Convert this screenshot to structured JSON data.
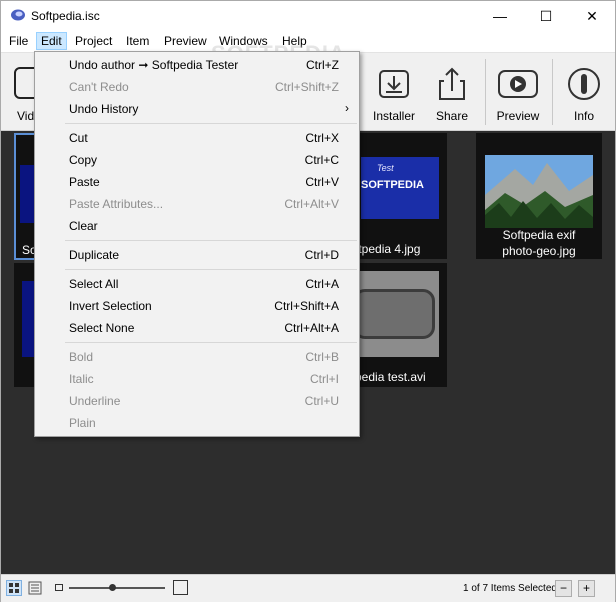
{
  "window": {
    "title": "Softpedia.isc",
    "controls": {
      "minimize": "—",
      "maximize": "☐",
      "close": "✕"
    }
  },
  "menubar": [
    "File",
    "Edit",
    "Project",
    "Item",
    "Preview",
    "Windows",
    "Help"
  ],
  "toolbar": {
    "partial_label": "Vid",
    "tools": [
      {
        "label": "Installer",
        "icon": "installer-icon"
      },
      {
        "label": "Share",
        "icon": "share-icon"
      },
      {
        "label": "Preview",
        "icon": "preview-icon"
      },
      {
        "label": "Info",
        "icon": "info-icon"
      }
    ]
  },
  "edit_menu": {
    "groups": [
      [
        {
          "label": "Undo author ➞ Softpedia Tester",
          "shortcut": "Ctrl+Z",
          "enabled": true
        },
        {
          "label": "Can't Redo",
          "shortcut": "Ctrl+Shift+Z",
          "enabled": false
        },
        {
          "label": "Undo History",
          "shortcut": "",
          "enabled": true,
          "submenu": true,
          "arrow": "›"
        }
      ],
      [
        {
          "label": "Cut",
          "shortcut": "Ctrl+X",
          "enabled": true
        },
        {
          "label": "Copy",
          "shortcut": "Ctrl+C",
          "enabled": true
        },
        {
          "label": "Paste",
          "shortcut": "Ctrl+V",
          "enabled": true
        },
        {
          "label": "Paste Attributes...",
          "shortcut": "Ctrl+Alt+V",
          "enabled": false
        },
        {
          "label": "Clear",
          "shortcut": "",
          "enabled": true
        }
      ],
      [
        {
          "label": "Duplicate",
          "shortcut": "Ctrl+D",
          "enabled": true
        }
      ],
      [
        {
          "label": "Select All",
          "shortcut": "Ctrl+A",
          "enabled": true
        },
        {
          "label": "Invert Selection",
          "shortcut": "Ctrl+Shift+A",
          "enabled": true
        },
        {
          "label": "Select None",
          "shortcut": "Ctrl+Alt+A",
          "enabled": true
        }
      ],
      [
        {
          "label": "Bold",
          "shortcut": "Ctrl+B",
          "enabled": false
        },
        {
          "label": "Italic",
          "shortcut": "Ctrl+I",
          "enabled": false
        },
        {
          "label": "Underline",
          "shortcut": "Ctrl+U",
          "enabled": false
        },
        {
          "label": "Plain",
          "shortcut": "",
          "enabled": false
        }
      ]
    ]
  },
  "thumbnails": [
    {
      "caption": "So",
      "variant": "selected-partial"
    },
    {
      "caption": "ftpedia 4.jpg",
      "overlay_text": "SOFTPEDIA",
      "overlay_script": "Test"
    },
    {
      "caption": "Softpedia exif\nphoto-geo.jpg"
    },
    {
      "caption": "",
      "variant": "dark-partial"
    },
    {
      "caption": "pedia test.avi"
    }
  ],
  "statusbar": {
    "status_text": "1 of 7 Items Selected",
    "minus": "−",
    "plus": "+",
    "zoom_level": 0.45
  },
  "watermark": "SOFTPEDIA"
}
